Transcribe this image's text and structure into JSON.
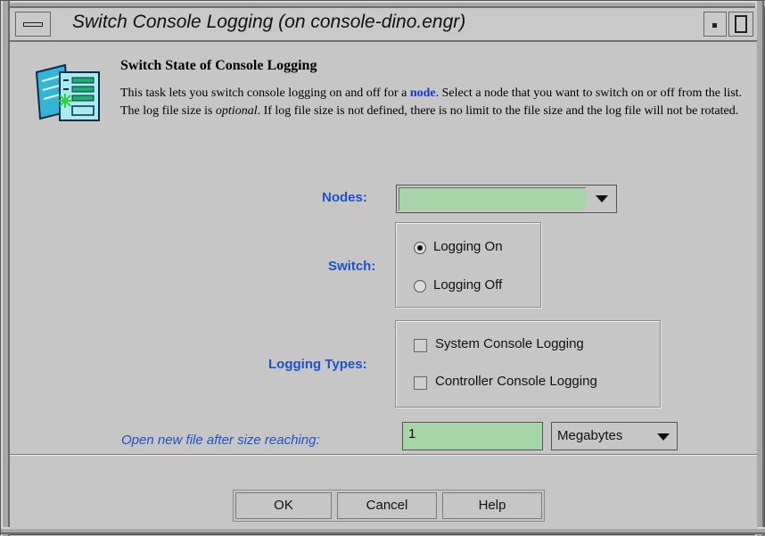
{
  "window": {
    "title": "Switch Console Logging (on console-dino.engr)"
  },
  "header": {
    "heading": "Switch State of Console Logging",
    "desc_part1": "This task lets you switch console logging on and off for a ",
    "desc_link": "node",
    "desc_part2": ".  Select a node that you want to switch on or off from the list. The log file size is ",
    "desc_italic": "optional",
    "desc_part3": ". If log file size is not defined, there is no limit to the file size and the log file will not be rotated."
  },
  "form": {
    "nodes_label": "Nodes:",
    "nodes_value": "",
    "switch_label": "Switch:",
    "switch_options": [
      "Logging On",
      "Logging Off"
    ],
    "switch_selected": "Logging On",
    "types_label": "Logging Types:",
    "type_options": [
      "System Console Logging",
      "Controller Console Logging"
    ],
    "size_label": "Open new file after size reaching:",
    "size_value": "1",
    "size_unit": "Megabytes"
  },
  "buttons": {
    "ok": "OK",
    "cancel": "Cancel",
    "help": "Help"
  },
  "colors": {
    "label_blue": "#1f51c8",
    "field_green": "#a7d5a7",
    "background": "#c6c6c6"
  },
  "icons": [
    "window-menu-icon",
    "minimize-icon",
    "maximize-icon",
    "task-icon",
    "dropdown-arrow-icon"
  ]
}
